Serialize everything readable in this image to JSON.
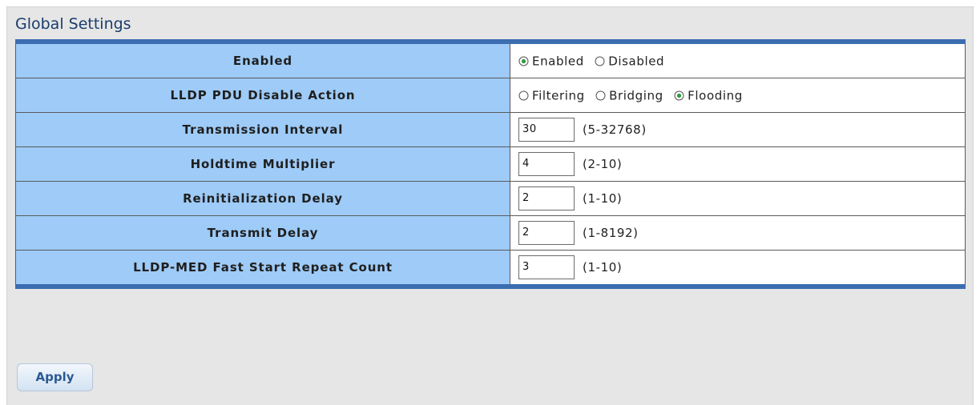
{
  "section": {
    "title": "Global Settings"
  },
  "rows": [
    {
      "label": "Enabled",
      "type": "radio",
      "options": [
        {
          "label": "Enabled",
          "selected": true
        },
        {
          "label": "Disabled",
          "selected": false
        }
      ]
    },
    {
      "label": "LLDP PDU Disable Action",
      "type": "radio",
      "options": [
        {
          "label": "Filtering",
          "selected": false
        },
        {
          "label": "Bridging",
          "selected": false
        },
        {
          "label": "Flooding",
          "selected": true
        }
      ]
    },
    {
      "label": "Transmission Interval",
      "type": "input",
      "value": "30",
      "range": "(5-32768)"
    },
    {
      "label": "Holdtime Multiplier",
      "type": "input",
      "value": "4",
      "range": "(2-10)"
    },
    {
      "label": "Reinitialization Delay",
      "type": "input",
      "value": "2",
      "range": "(1-10)"
    },
    {
      "label": "Transmit Delay",
      "type": "input",
      "value": "2",
      "range": "(1-8192)"
    },
    {
      "label": "LLDP-MED Fast Start Repeat Count",
      "type": "input",
      "value": "3",
      "range": "(1-10)"
    }
  ],
  "buttons": {
    "apply_label": "Apply"
  },
  "colors": {
    "label_bg": "#9ecbf7",
    "table_accent": "#3b6db0",
    "title_color": "#1a3d6b",
    "button_text": "#2b5a93"
  }
}
